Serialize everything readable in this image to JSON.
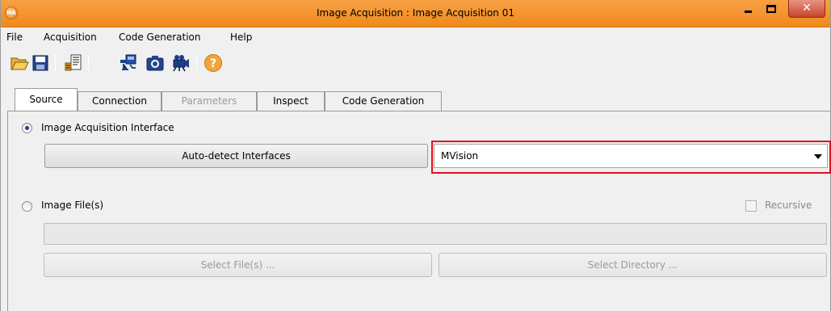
{
  "window": {
    "title": "Image Acquisition : Image Acquisition 01",
    "app_icon_text": "HA",
    "close_glyph": "✕"
  },
  "menu": {
    "items": [
      "File",
      "Acquisition",
      "Code Generation",
      "Help"
    ]
  },
  "toolbar": {
    "icons": [
      "open-folder-icon",
      "save-icon",
      "insert-code-icon",
      "connect-icon",
      "snap-camera-icon",
      "live-video-icon",
      "help-icon"
    ]
  },
  "tabs": [
    {
      "label": "Source",
      "active": true,
      "enabled": true
    },
    {
      "label": "Connection",
      "active": false,
      "enabled": true
    },
    {
      "label": "Parameters",
      "active": false,
      "enabled": false
    },
    {
      "label": "Inspect",
      "active": false,
      "enabled": true
    },
    {
      "label": "Code Generation",
      "active": false,
      "enabled": true
    }
  ],
  "source": {
    "interface_option": {
      "label": "Image Acquisition Interface",
      "checked": true
    },
    "autodetect_button": "Auto-detect Interfaces",
    "interface_select": {
      "value": "MVision"
    },
    "file_option": {
      "label": "Image File(s)",
      "checked": false
    },
    "recursive": {
      "label": "Recursive",
      "checked": false,
      "enabled": false
    },
    "file_path": {
      "value": ""
    },
    "select_files_button": "Select File(s) ...",
    "select_directory_button": "Select Directory ..."
  },
  "colors": {
    "titlebar": "#ef8a1c",
    "highlight": "#e0101d",
    "radio_dot": "#1d3f8a"
  }
}
